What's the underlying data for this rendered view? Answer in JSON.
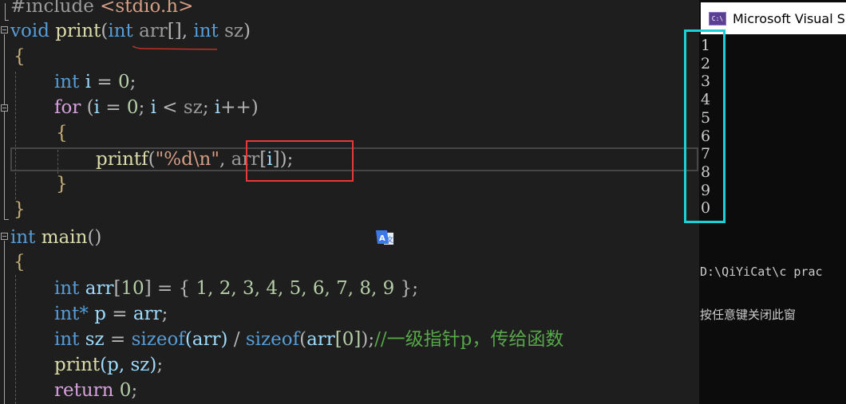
{
  "editor": {
    "lines": {
      "include": {
        "directive": "#include",
        "header": "<stdio.h>"
      },
      "print_sig": {
        "ret": "void",
        "name": "print",
        "open": "(",
        "t1": "int",
        "p1": "arr",
        "br": "[]",
        "comma": ", ",
        "t2": "int",
        "p2": "sz",
        "close": ")"
      },
      "open_brace_1": "{",
      "int_i": {
        "t": "int",
        "v": "i",
        "eq": " = ",
        "n": "0",
        "semi": ";"
      },
      "for_loop": {
        "kw": "for",
        "open": " (",
        "v1": "i",
        "eq": " = ",
        "n": "0",
        "s1": "; ",
        "v2": "i",
        "lt": " < ",
        "sz": "sz",
        "s2": "; ",
        "v3": "i",
        "inc": "++)"
      },
      "open_brace_2": "{",
      "printf_line": {
        "fn": "printf",
        "open": "(",
        "fmt": "\"%d\\n\"",
        "comma": ", ",
        "arr": "arr",
        "lb": "[",
        "i": "i",
        "rb": "]",
        "close": ");"
      },
      "close_brace_2": "}",
      "close_brace_1": "}",
      "main_sig": {
        "ret": "int",
        "name": "main",
        "parens": "()"
      },
      "open_brace_3": "{",
      "arr_decl": {
        "t": "int",
        "v": "arr",
        "lb": "[",
        "size": "10",
        "rb": "]",
        "eq": " = ",
        "ob": "{ ",
        "values": "1, 2, 3, 4, 5, 6, 7, 8, 9",
        "cb": " }",
        "semi": ";"
      },
      "ptr_decl": {
        "t": "int*",
        "v": "p",
        "eq": " = ",
        "rhs": "arr",
        "semi": ";"
      },
      "sz_decl": {
        "t": "int",
        "v": "sz",
        "eq": " = ",
        "op1": "sizeof",
        "a1": "(arr)",
        "div": " / ",
        "op2": "sizeof",
        "a2o": "(",
        "a2": "arr",
        "a2b": "[0]",
        "a2c": ")",
        "semi": ";",
        "comment": "//一级指针p，传给函数"
      },
      "call": {
        "fn": "print",
        "args": "(p, sz)",
        "semi": ";"
      },
      "ret": {
        "kw": "return",
        "n": "0",
        "semi": ";"
      }
    }
  },
  "console": {
    "title": "Microsoft Visual S",
    "icon_label": "C:\\",
    "output": [
      "1",
      "2",
      "3",
      "4",
      "5",
      "6",
      "7",
      "8",
      "9",
      "0"
    ],
    "path_line": "D:\\QiYiCat\\c prac",
    "prompt_line": "按任意键关闭此窗"
  },
  "annotations": {
    "red_box_color": "#e8393a",
    "cyan_box_color": "#19d1d6"
  }
}
